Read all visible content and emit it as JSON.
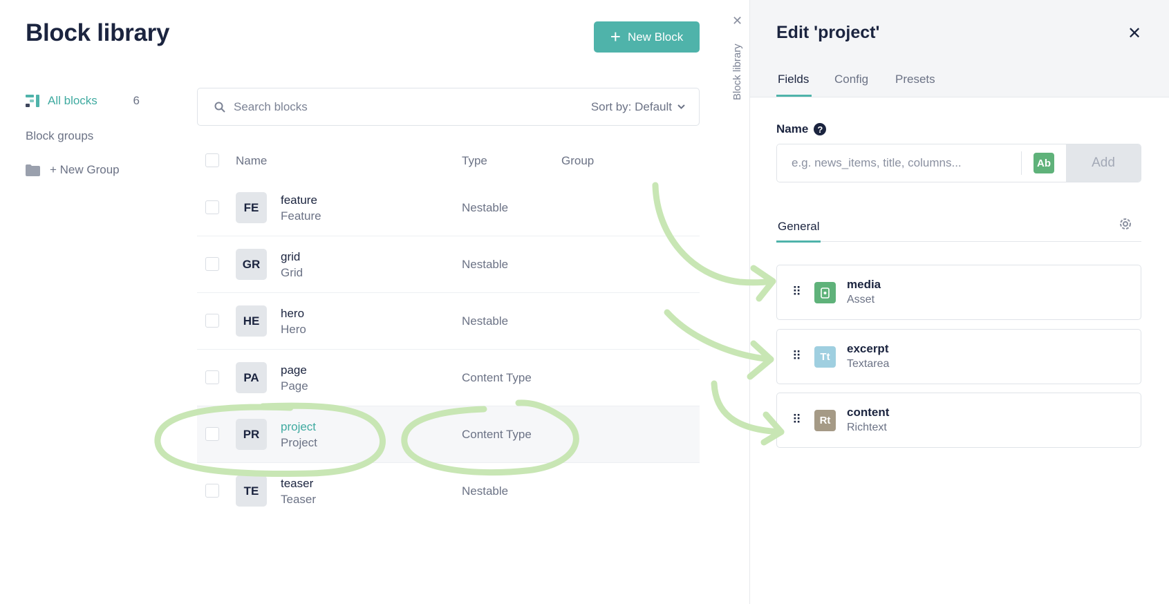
{
  "library": {
    "title": "Block library",
    "new_block_label": "New Block",
    "sidebar": {
      "all_blocks_label": "All blocks",
      "all_blocks_count": "6",
      "groups_heading": "Block groups",
      "new_group_label": "+ New Group"
    },
    "search": {
      "placeholder": "Search blocks",
      "sort_label": "Sort by: Default"
    },
    "table": {
      "headers": {
        "name": "Name",
        "type": "Type",
        "group": "Group"
      },
      "rows": [
        {
          "initials": "FE",
          "name": "feature",
          "display": "Feature",
          "type": "Nestable"
        },
        {
          "initials": "GR",
          "name": "grid",
          "display": "Grid",
          "type": "Nestable"
        },
        {
          "initials": "HE",
          "name": "hero",
          "display": "Hero",
          "type": "Nestable"
        },
        {
          "initials": "PA",
          "name": "page",
          "display": "Page",
          "type": "Content Type"
        },
        {
          "initials": "PR",
          "name": "project",
          "display": "Project",
          "type": "Content Type"
        },
        {
          "initials": "TE",
          "name": "teaser",
          "display": "Teaser",
          "type": "Nestable"
        }
      ]
    }
  },
  "side_tab": {
    "label": "Block library"
  },
  "editor": {
    "title": "Edit 'project'",
    "tabs": [
      "Fields",
      "Config",
      "Presets"
    ],
    "name_label": "Name",
    "name_placeholder": "e.g. news_items, title, columns...",
    "ab_badge": "Ab",
    "add_label": "Add",
    "general_tab": "General",
    "fields": [
      {
        "name": "media",
        "type": "Asset",
        "icon": "asset-icon",
        "badge": "",
        "color": "#5fb27a"
      },
      {
        "name": "excerpt",
        "type": "Textarea",
        "icon": "textarea-icon",
        "badge": "Tt",
        "color": "#9fcfe0"
      },
      {
        "name": "content",
        "type": "Richtext",
        "icon": "richtext-icon",
        "badge": "Rt",
        "color": "#a59a86"
      }
    ]
  },
  "colors": {
    "accent": "#4fb3aa",
    "annotation": "#c8e6b4"
  }
}
